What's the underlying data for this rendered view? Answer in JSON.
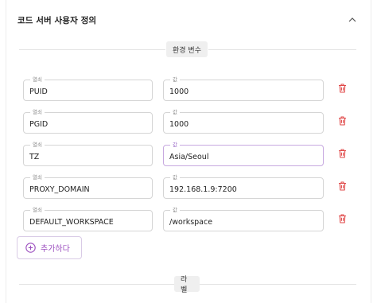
{
  "panel": {
    "title": "코드 서버 사용자 정의"
  },
  "sections": {
    "env": "환경 변수",
    "labels": "라벨"
  },
  "env_vars": [
    {
      "name_label": "열쇠",
      "name": "PUID",
      "value_label": "값",
      "value": "1000"
    },
    {
      "name_label": "열쇠",
      "name": "PGID",
      "value_label": "값",
      "value": "1000"
    },
    {
      "name_label": "열쇠",
      "name": "TZ",
      "value_label": "값",
      "value": "Asia/Seoul"
    },
    {
      "name_label": "열쇠",
      "name": "PROXY_DOMAIN",
      "value_label": "값",
      "value": "192.168.1.9:7200"
    },
    {
      "name_label": "열쇠",
      "name": "DEFAULT_WORKSPACE",
      "value_label": "값",
      "value": "/workspace"
    }
  ],
  "add_button": {
    "label": "추가하다"
  },
  "colors": {
    "accent": "#9c4fbf",
    "delete": "#e04848",
    "focus_border": "#c7a9e0"
  },
  "icons": {
    "collapse": "chevron-up-icon",
    "delete": "trash-icon",
    "add": "plus-circle-icon"
  }
}
